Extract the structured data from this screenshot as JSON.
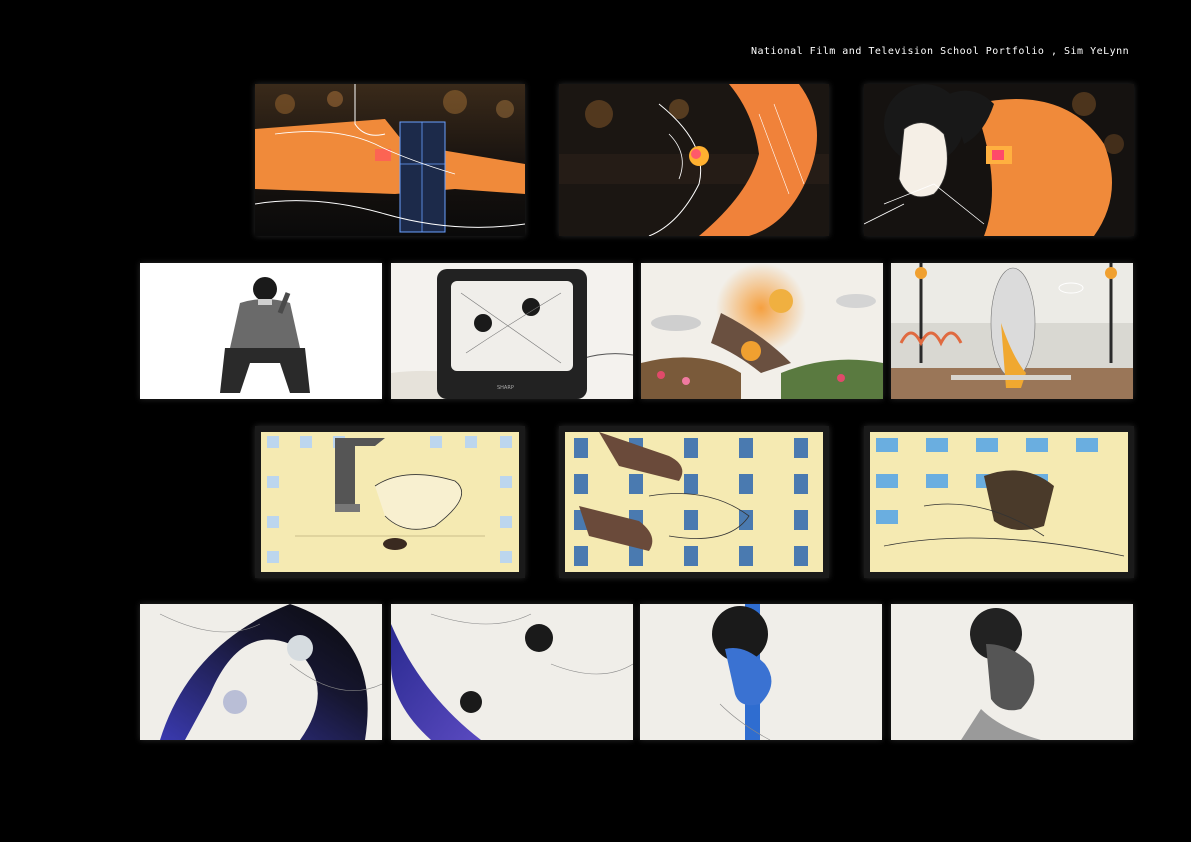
{
  "header": {
    "title": "National Film and Television School Portfolio , Sim YeLynn"
  },
  "tv": {
    "brand": "SHARP"
  },
  "frames": [
    {
      "name": "frame-night-arm-hand"
    },
    {
      "name": "frame-night-arm-reach"
    },
    {
      "name": "frame-night-couple-embrace"
    },
    {
      "name": "frame-portrait-seated"
    },
    {
      "name": "frame-crt-tv"
    },
    {
      "name": "frame-flower-collage"
    },
    {
      "name": "frame-pier-lovers"
    },
    {
      "name": "frame-handwashing"
    },
    {
      "name": "frame-food-cans"
    },
    {
      "name": "frame-face-masks"
    },
    {
      "name": "frame-cosmic-swirl"
    },
    {
      "name": "frame-blue-swirl"
    },
    {
      "name": "frame-profile-blue"
    },
    {
      "name": "frame-profile-gray"
    }
  ]
}
